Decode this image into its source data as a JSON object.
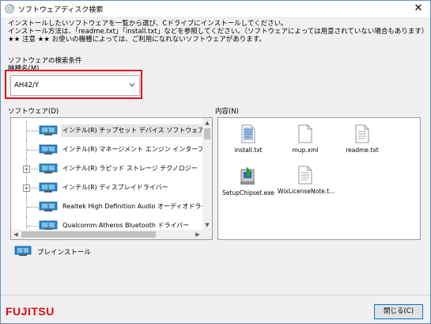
{
  "window": {
    "title": "ソフトウェアディスク検索",
    "close_glyph": "✕"
  },
  "instructions": [
    "インストールしたいソフトウェアを一覧から選び、Cドライブにインストールしてください。",
    "インストール方法は、「readme.txt」「install.txt」などを参照してください。（ソフトウェアによっては用意されていない場合もあります）",
    "★★ 注意 ★★ お使いの機種によっては、ご利用になれないソフトウェアがあります。"
  ],
  "search": {
    "section_label": "ソフトウェアの検索条件",
    "model_label": "機種名(M)",
    "model_value": "AH42/Y"
  },
  "software": {
    "label": "ソフトウェア(D)",
    "items": [
      {
        "label": "インテル(R) チップセット デバイス ソフトウェア",
        "expander": "",
        "selected": true
      },
      {
        "label": "インテル(R) マネージメント エンジン インターフェイス",
        "expander": "",
        "selected": false
      },
      {
        "label": "インテル(R) ラピッド ストレージ テクノロジー",
        "expander": "+",
        "selected": false
      },
      {
        "label": "インテル(R) ディスプレイドライバー",
        "expander": "+",
        "selected": false
      },
      {
        "label": "Realtek High Definition Audio オーディオドライバー",
        "expander": "",
        "selected": false
      },
      {
        "label": "Qualcomm Atheros Bluetooth ドライバー",
        "expander": "",
        "selected": false
      }
    ],
    "scroll_up": "▲",
    "scroll_down": "▼",
    "scroll_left": "◀",
    "scroll_right": "▶"
  },
  "legend": {
    "preinstall_label": "プレインストール"
  },
  "contents": {
    "label": "内容(N)",
    "files": [
      {
        "name": "install.txt",
        "icon": "text-file-icon"
      },
      {
        "name": "mup.xml",
        "icon": "document-icon"
      },
      {
        "name": "readme.txt",
        "icon": "text-file-icon"
      },
      {
        "name": "SetupChipset.exe",
        "icon": "installer-icon"
      },
      {
        "name": "WixLicenseNote.t...",
        "icon": "text-file-icon"
      }
    ]
  },
  "footer": {
    "brand": "FUJITSU",
    "close_button": "閉じる(C)"
  },
  "colors": {
    "highlight_frame": "#e3131c",
    "brand_red": "#e30613",
    "button_focus": "#0078d7"
  }
}
